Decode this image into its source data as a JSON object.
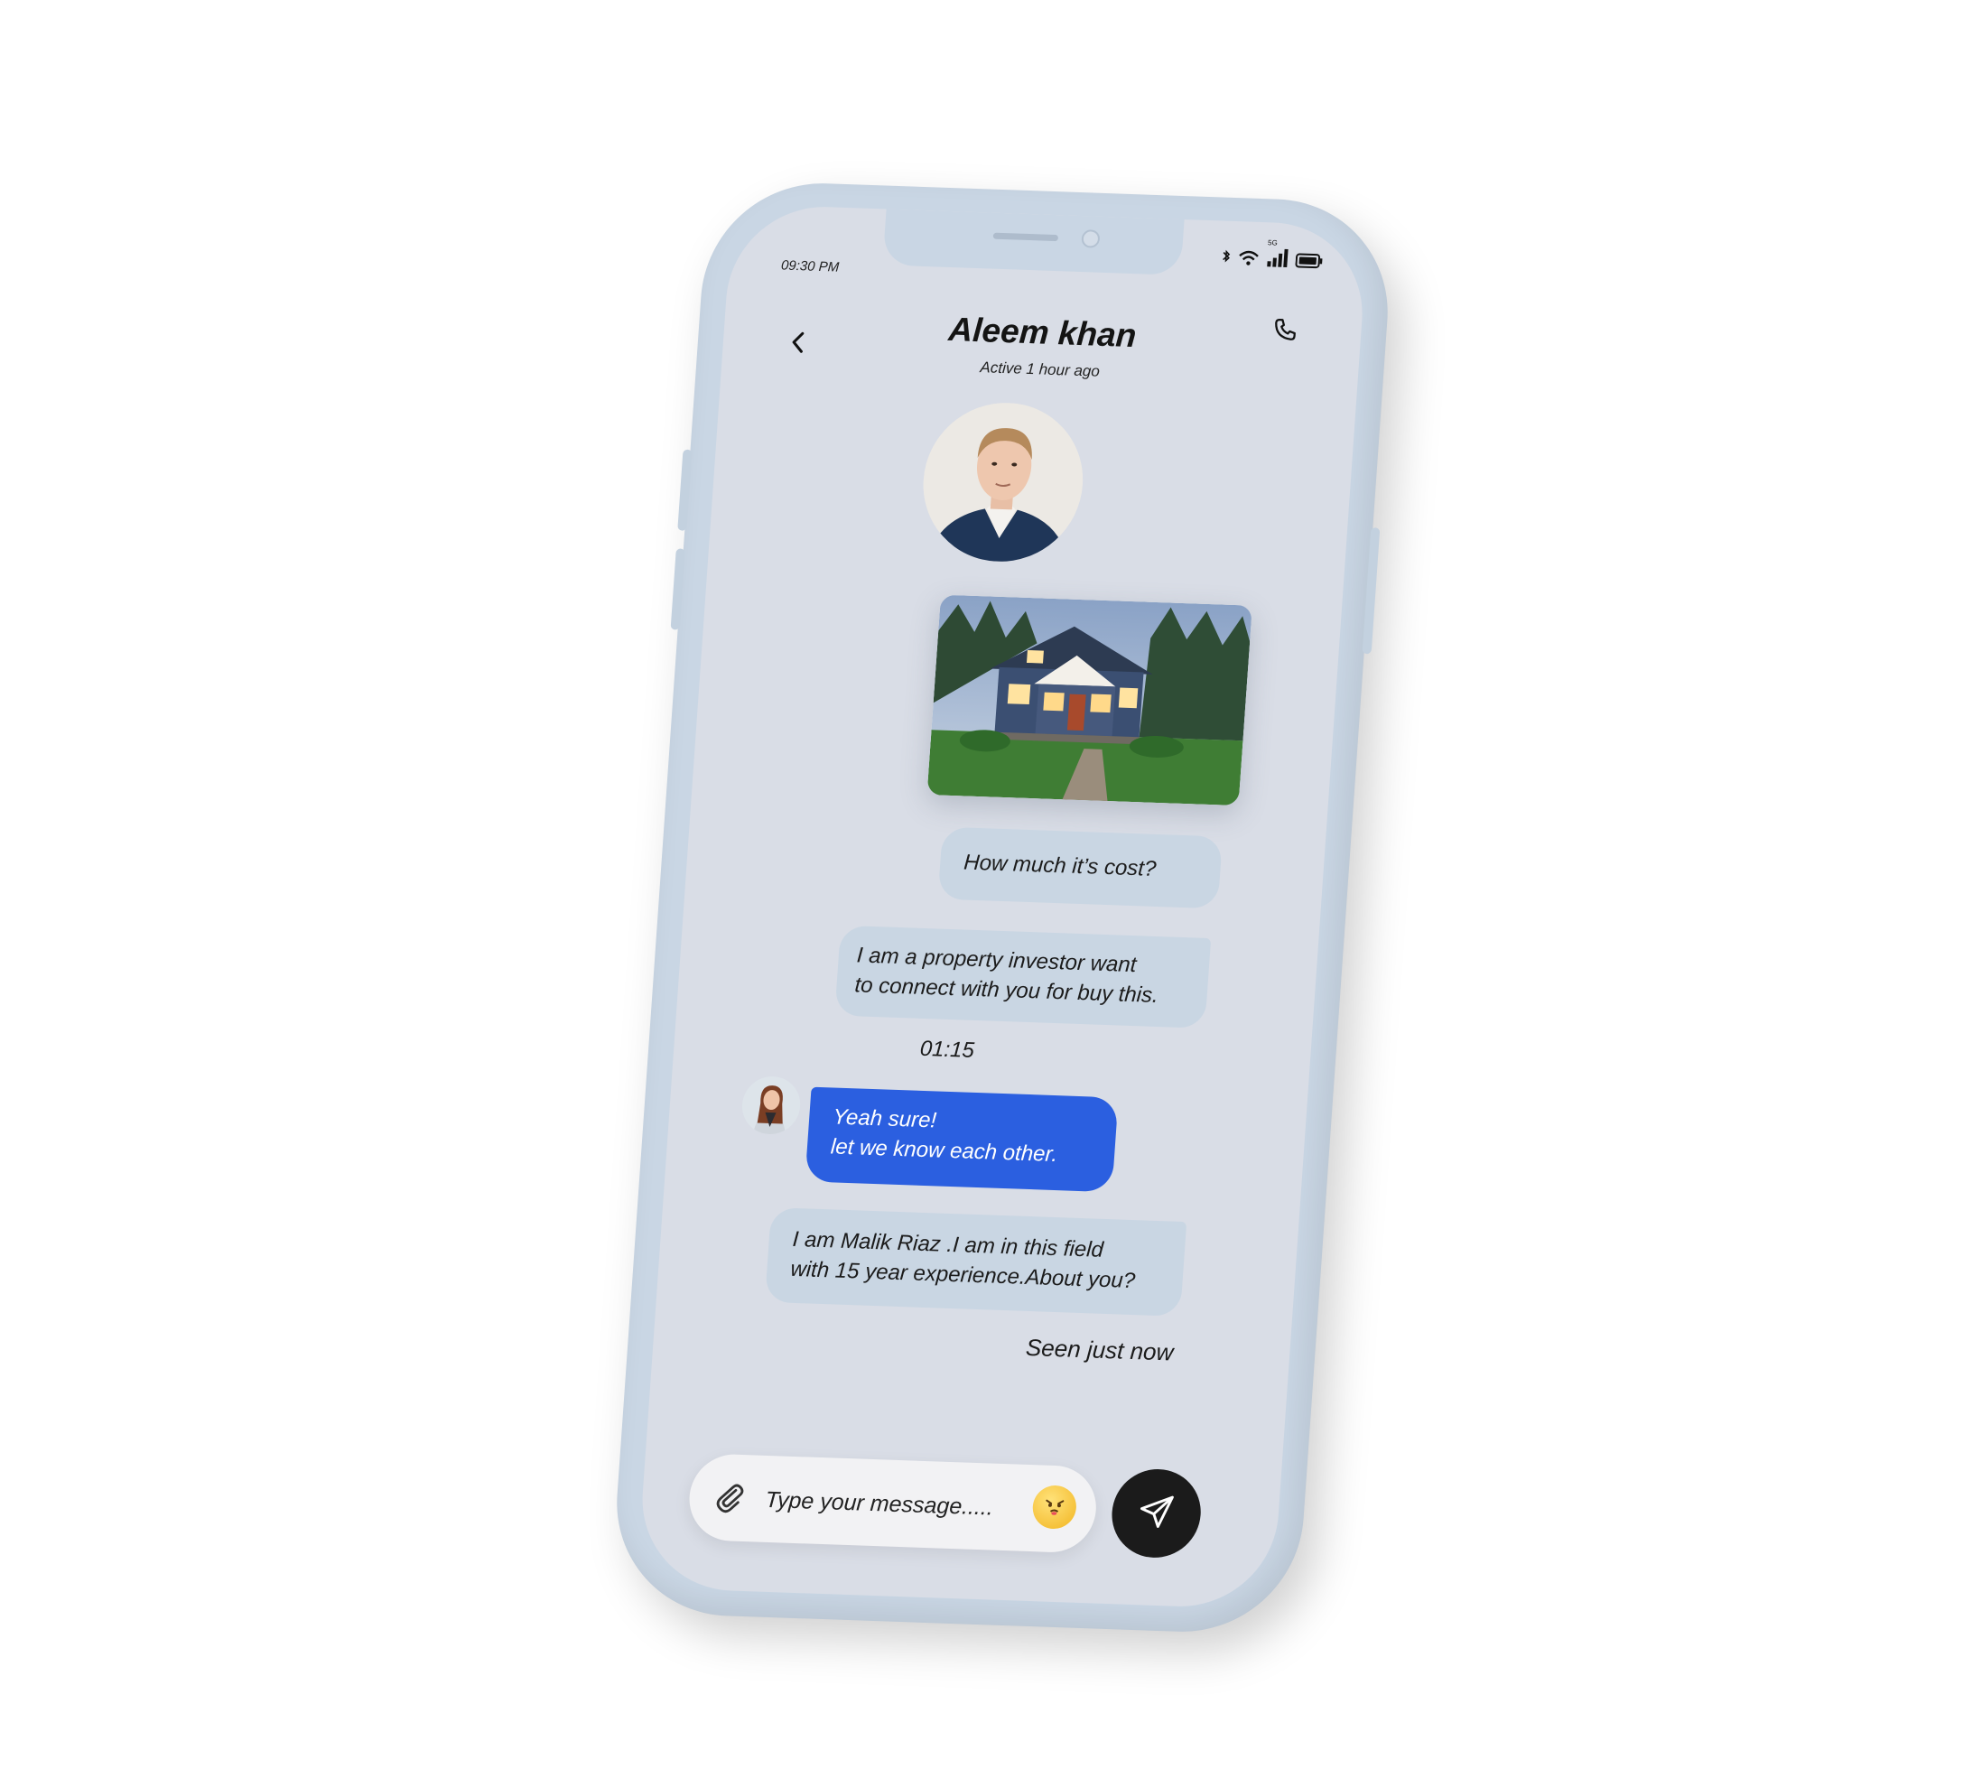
{
  "status_bar": {
    "time": "09:30 PM",
    "network_badge": "5G"
  },
  "header": {
    "contact_name": "Aleem khan",
    "contact_status": "Active 1 hour ago"
  },
  "messages": [
    {
      "kind": "sent",
      "text": "How much it’s cost?"
    },
    {
      "kind": "sent",
      "lines": [
        "I am a property investor want",
        "to connect with you for buy this."
      ]
    },
    {
      "kind": "timestamp",
      "text": "01:15"
    },
    {
      "kind": "received",
      "lines": [
        "Yeah sure!",
        "let we know each other."
      ]
    },
    {
      "kind": "sent",
      "lines": [
        "I am Malik Riaz .I am in this field",
        "with 15 year experience.About you?"
      ]
    }
  ],
  "read_receipt": "Seen just now",
  "composer": {
    "placeholder": "Type your message....."
  },
  "icons": {
    "back": "chevron-left-icon",
    "call": "phone-icon",
    "attach": "paperclip-icon",
    "emoji": "emoji-icon",
    "send": "send-icon"
  },
  "colors": {
    "phone_body": "#c9d6e4",
    "screen_bg": "#d9dde6",
    "sent_bubble": "#c9d6e3",
    "received_bubble": "#2b5fe0",
    "send_button": "#1b1b1b"
  }
}
